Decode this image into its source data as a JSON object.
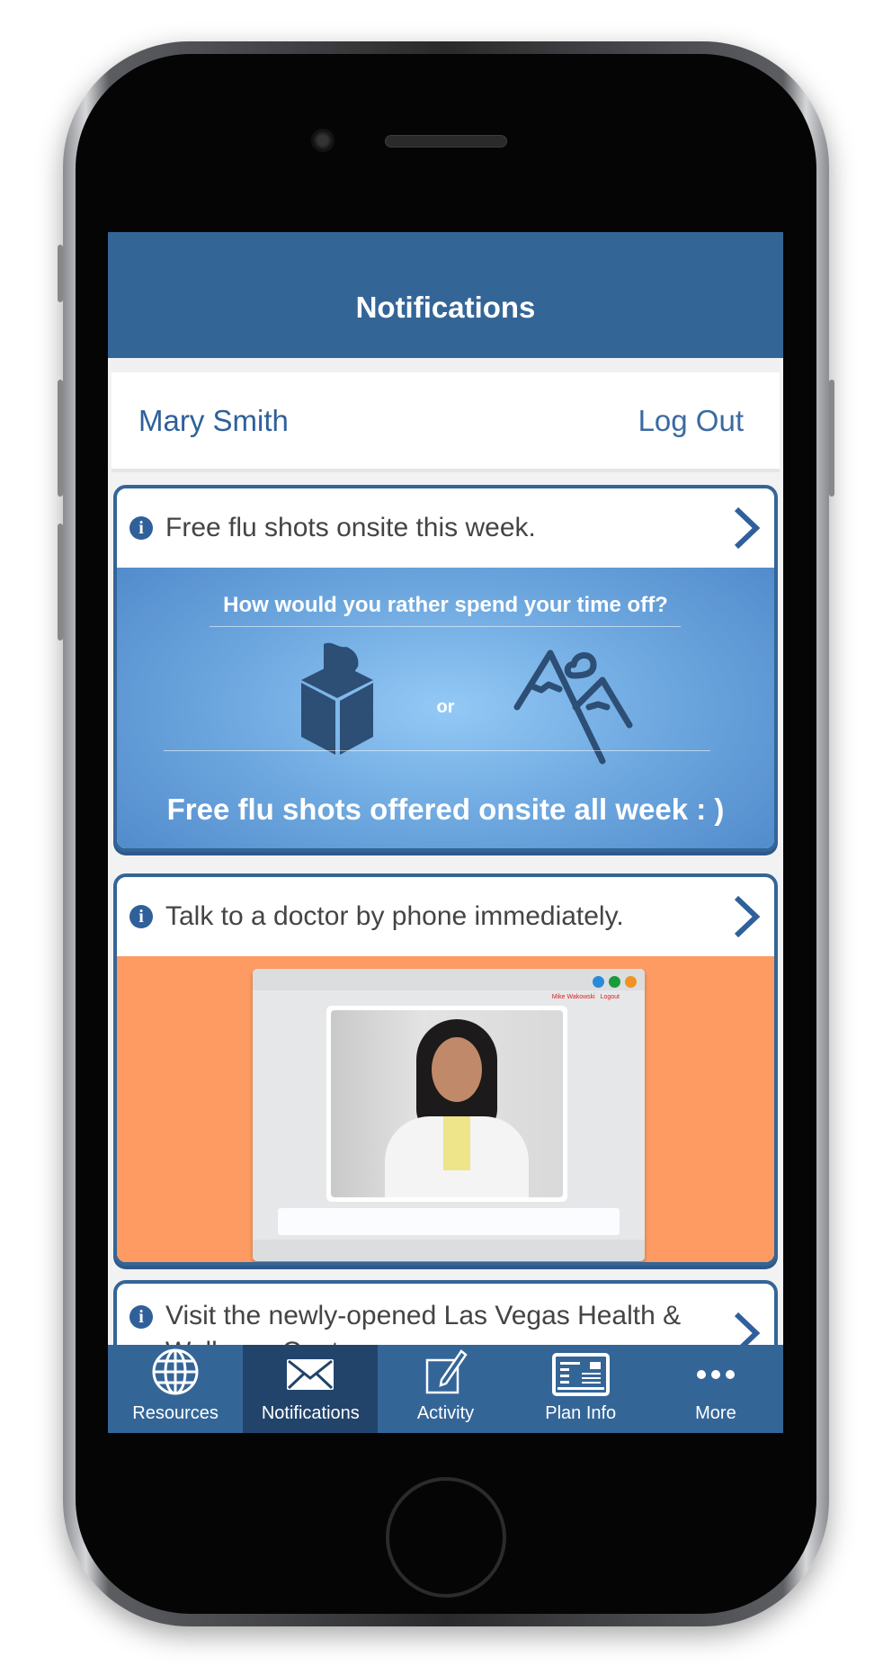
{
  "header": {
    "title": "Notifications"
  },
  "user": {
    "name": "Mary Smith",
    "logout_label": "Log Out"
  },
  "notifications": [
    {
      "title": "Free flu shots onsite this week.",
      "banner": {
        "question": "How would you rather spend your time off?",
        "or": "or",
        "headline": "Free flu shots offered onsite all week : )",
        "bg_color": "#4d86c8"
      }
    },
    {
      "title": "Talk to a doctor by phone immediately.",
      "banner": {
        "user": "Mike Wakowski",
        "logout": "Logout",
        "bg_color": "#fe9b62"
      }
    },
    {
      "title": "Visit the newly-opened Las Vegas Health & Wellness Center"
    }
  ],
  "tabs": [
    {
      "label": "Resources",
      "icon": "globe-icon"
    },
    {
      "label": "Notifications",
      "icon": "envelope-icon",
      "active": true
    },
    {
      "label": "Activity",
      "icon": "edit-icon"
    },
    {
      "label": "Plan Info",
      "icon": "id-card-icon"
    },
    {
      "label": "More",
      "icon": "more-icon"
    }
  ],
  "colors": {
    "brand": "#346597",
    "active_tab": "#22446b"
  }
}
